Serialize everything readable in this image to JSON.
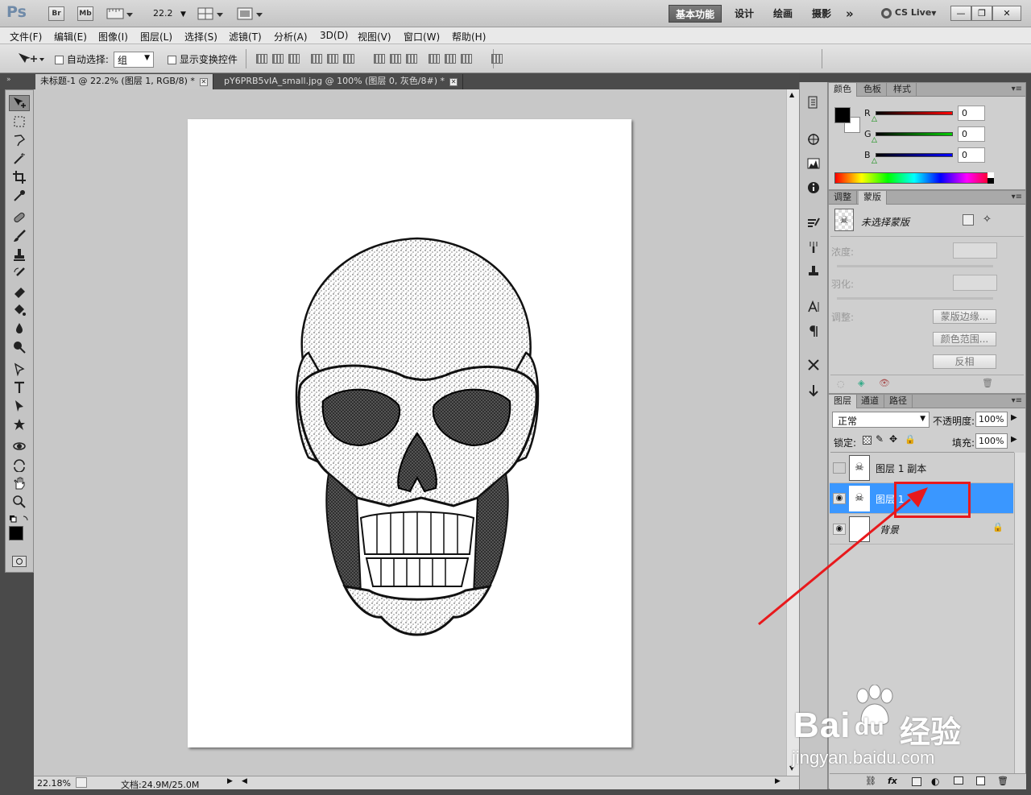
{
  "app": {
    "logo": "Ps",
    "launch_icons": [
      "Br",
      "Mb"
    ],
    "zoom_display": "22.2",
    "workspaces": [
      "基本功能",
      "设计",
      "绘画",
      "摄影"
    ],
    "active_workspace": "基本功能",
    "more_label": "»",
    "cs_live": "CS Live",
    "window_controls": [
      "minimize",
      "restore",
      "close"
    ]
  },
  "menu": [
    "文件(F)",
    "编辑(E)",
    "图像(I)",
    "图层(L)",
    "选择(S)",
    "滤镜(T)",
    "分析(A)",
    "3D(D)",
    "视图(V)",
    "窗口(W)",
    "帮助(H)"
  ],
  "options": {
    "auto_select_label": "自动选择:",
    "auto_select_value": "组",
    "show_transform_label": "显示变换控件"
  },
  "tabs": [
    {
      "label": "未标题-1 @ 22.2% (图层 1, RGB/8) *",
      "active": true
    },
    {
      "label": "pY6PRB5vIA_small.jpg @ 100% (图层 0, 灰色/8#) *",
      "active": false
    }
  ],
  "status": {
    "zoom": "22.18%",
    "doc": "文档:24.9M/25.0M"
  },
  "color_panel": {
    "tabs": [
      "颜色",
      "色板",
      "样式"
    ],
    "channels": [
      {
        "label": "R",
        "value": "0",
        "color": "#ff0000"
      },
      {
        "label": "G",
        "value": "0",
        "color": "#00cc00"
      },
      {
        "label": "B",
        "value": "0",
        "color": "#0000ff"
      }
    ]
  },
  "mask_panel": {
    "tabs": [
      "调整",
      "蒙版"
    ],
    "title": "未选择蒙版",
    "density_label": "浓度:",
    "feather_label": "羽化:",
    "refine_label": "调整:",
    "buttons": [
      "蒙版边缘...",
      "颜色范围...",
      "反相"
    ]
  },
  "layers_panel": {
    "tabs": [
      "图层",
      "通道",
      "路径"
    ],
    "blend_mode": "正常",
    "opacity_label": "不透明度:",
    "opacity": "100%",
    "lock_label": "锁定:",
    "fill_label": "填充:",
    "fill": "100%",
    "layers": [
      {
        "name": "图层 1 副本",
        "visible": false,
        "selected": false,
        "locked": false
      },
      {
        "name": "图层 1",
        "visible": true,
        "selected": true,
        "locked": false
      },
      {
        "name": "背景",
        "visible": true,
        "selected": false,
        "locked": true
      }
    ],
    "footer_icons": [
      "link-icon",
      "fx",
      "mask-icon",
      "adjustment-icon",
      "group-icon",
      "new-layer-icon",
      "trash-icon"
    ]
  },
  "watermark": {
    "brand": "Bai",
    "brand_suffix": "经验",
    "url": "jingyan.baidu.com"
  },
  "colors": {
    "selection": "#3a97ff",
    "annotation": "#e8191c"
  }
}
